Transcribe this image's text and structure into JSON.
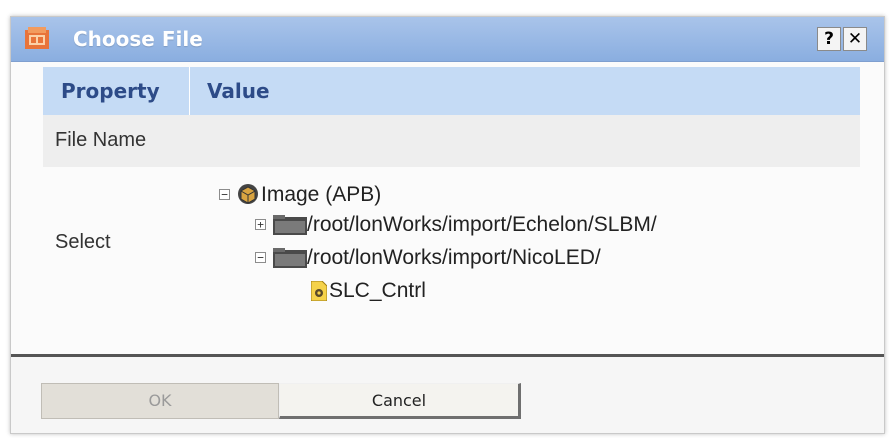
{
  "dialog": {
    "title": "Choose File",
    "help_label": "?",
    "close_label": "✕"
  },
  "grid": {
    "header_property": "Property",
    "header_value": "Value",
    "rows": [
      {
        "label": "File Name",
        "value": ""
      },
      {
        "label": "Select"
      }
    ]
  },
  "tree": {
    "root": {
      "label": "Image (APB)",
      "expander": "−",
      "icon": "image-package-icon"
    },
    "nodes": [
      {
        "label": "/root/lonWorks/import/Echelon/SLBM/",
        "expander": "+",
        "icon": "folder-icon"
      },
      {
        "label": "/root/lonWorks/import/NicoLED/",
        "expander": "−",
        "icon": "folder-icon"
      },
      {
        "label": "SLC_Cntrl",
        "icon": "file-icon"
      }
    ]
  },
  "footer": {
    "ok_label": "OK",
    "cancel_label": "Cancel"
  },
  "colors": {
    "titlebar": "#9bb9e6",
    "header_bg": "#c5dbf5",
    "header_text": "#2d4b88",
    "row_alt": "#eeeeee",
    "divider": "#555555"
  }
}
